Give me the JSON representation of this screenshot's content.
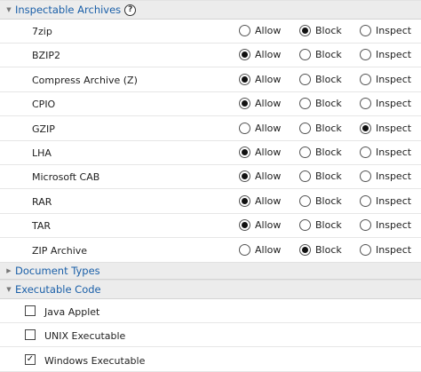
{
  "sections": {
    "inspectable": {
      "title": "Inspectable Archives",
      "help_glyph": "?"
    },
    "document": {
      "title": "Document Types"
    },
    "executable": {
      "title": "Executable Code"
    }
  },
  "options": {
    "allow": "Allow",
    "block": "Block",
    "inspect": "Inspect"
  },
  "archives": [
    {
      "name": "7zip",
      "selected": "block"
    },
    {
      "name": "BZIP2",
      "selected": "allow"
    },
    {
      "name": "Compress Archive (Z)",
      "selected": "allow"
    },
    {
      "name": "CPIO",
      "selected": "allow"
    },
    {
      "name": "GZIP",
      "selected": "inspect"
    },
    {
      "name": "LHA",
      "selected": "allow"
    },
    {
      "name": "Microsoft CAB",
      "selected": "allow"
    },
    {
      "name": "RAR",
      "selected": "allow"
    },
    {
      "name": "TAR",
      "selected": "allow"
    },
    {
      "name": "ZIP Archive",
      "selected": "block"
    }
  ],
  "executables": [
    {
      "name": "Java Applet",
      "checked": false
    },
    {
      "name": "UNIX Executable",
      "checked": false
    },
    {
      "name": "Windows Executable",
      "checked": true
    }
  ],
  "icons": {
    "expanded": "triangle-down-icon",
    "collapsed": "triangle-right-icon"
  },
  "colors": {
    "header_text": "#1a5fa8",
    "header_bg": "#ececec"
  }
}
